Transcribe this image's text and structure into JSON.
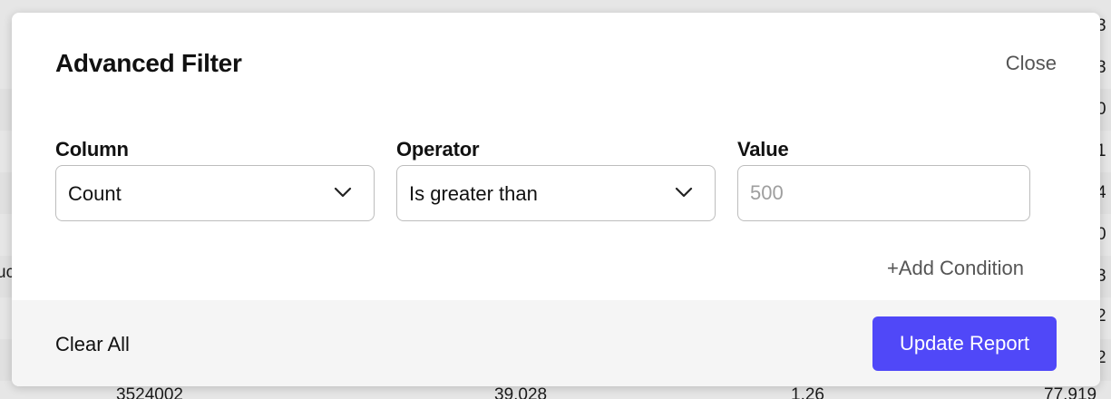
{
  "modal": {
    "title": "Advanced Filter",
    "close_label": "Close"
  },
  "fields": {
    "column": {
      "label": "Column",
      "selected": "Count",
      "icon": "chevron-down-icon"
    },
    "operator": {
      "label": "Operator",
      "selected": "Is greater than",
      "icon": "chevron-down-icon"
    },
    "value": {
      "label": "Value",
      "value": "",
      "placeholder": "500"
    }
  },
  "add_condition_label": "+Add Condition",
  "footer": {
    "clear_label": "Clear All",
    "update_label": "Update Report"
  },
  "background": {
    "left_fragment": "uc",
    "bottom_row": [
      "3524002",
      "39.028",
      "1.26",
      "77.919"
    ],
    "right_digits": [
      "3",
      "3",
      "0",
      "1",
      "4",
      "0",
      "3",
      "2",
      "2"
    ]
  },
  "colors": {
    "accent": "#5048f8",
    "overlay": "#e6e6e6"
  }
}
